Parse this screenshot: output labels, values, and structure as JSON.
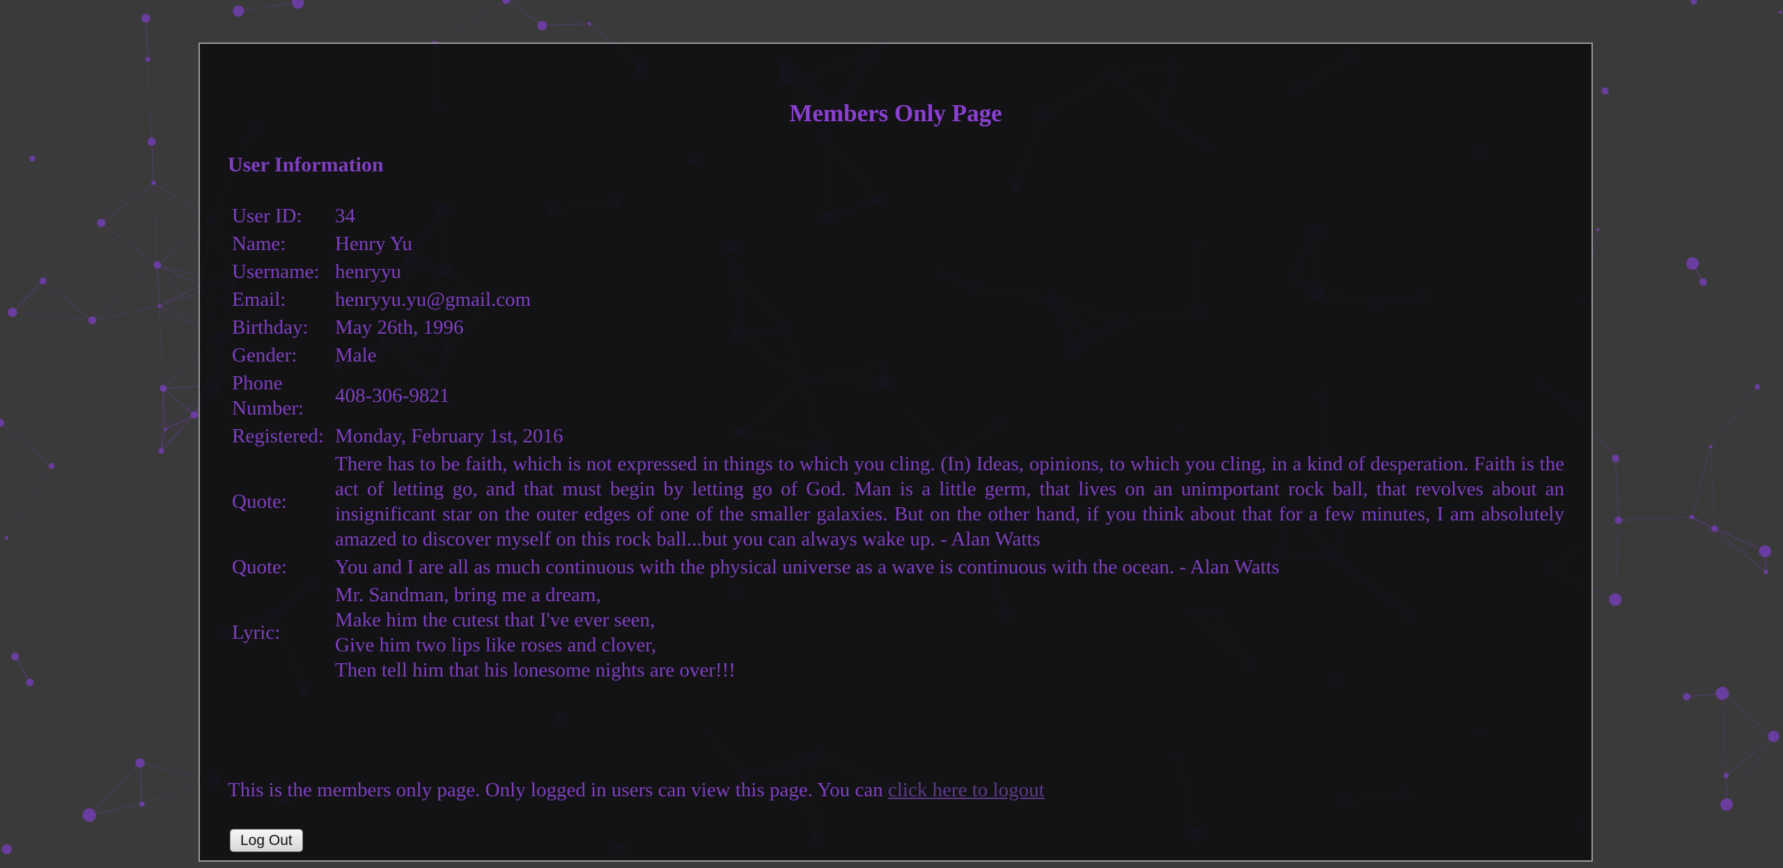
{
  "page": {
    "title": "Members Only Page",
    "section_title": "User Information"
  },
  "user_info": {
    "user_id": {
      "label": "User ID:",
      "value": "34"
    },
    "name": {
      "label": "Name:",
      "value": "Henry Yu"
    },
    "username": {
      "label": "Username:",
      "value": "henryyu"
    },
    "email": {
      "label": "Email:",
      "value": "henryyu.yu@gmail.com"
    },
    "birthday": {
      "label": "Birthday:",
      "value": "May 26th, 1996"
    },
    "gender": {
      "label": "Gender:",
      "value": "Male"
    },
    "phone": {
      "label": "Phone Number:",
      "value": "408-306-9821"
    },
    "registered": {
      "label": "Registered:",
      "value": "Monday, February 1st, 2016"
    },
    "quote1": {
      "label": "Quote:",
      "value": "There has to be faith, which is not expressed in things to which you cling. (In) Ideas, opinions, to which you cling, in a kind of desperation. Faith is the act of letting go, and that must begin by letting go of God. Man is a little germ, that lives on an unimportant rock ball, that revolves about an insignificant star on the outer edges of one of the smaller galaxies. But on the other hand, if you think about that for a few minutes, I am absolutely amazed to discover myself on this rock ball...but you can always wake up. - Alan Watts"
    },
    "quote2": {
      "label": "Quote:",
      "value": "You and I are all as much continuous with the physical universe as a wave is continuous with the ocean. - Alan Watts"
    },
    "lyric": {
      "label": "Lyric:",
      "lines": [
        "Mr. Sandman, bring me a dream,",
        "Make him the cutest that I've ever seen,",
        "Give him two lips like roses and clover,",
        "Then tell him that his lonesome nights are over!!!"
      ]
    }
  },
  "footer": {
    "text": "This is the members only page. Only logged in users can view this page. You can ",
    "link_text": "click here to logout"
  },
  "logout_button": {
    "label": "Log Out"
  },
  "colors": {
    "accent": "#7e3fc0",
    "panel_bg": "#111113",
    "page_bg": "#3a3a3a",
    "link": "#5c3a8a"
  }
}
